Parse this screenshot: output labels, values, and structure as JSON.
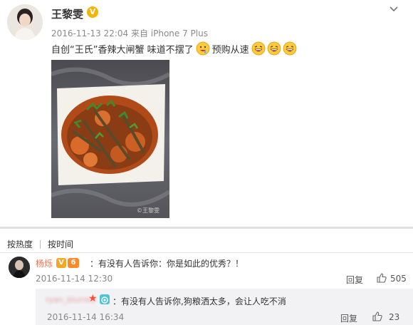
{
  "post": {
    "username": "王黎雯",
    "verified_badge": "V",
    "timestamp": "2016-11-13 22:04",
    "source": "来自 iPhone 7 Plus",
    "content_parts": [
      "自创“王氏”香辣大闸蟹 味道不摆了",
      "预购从速"
    ],
    "emojis": [
      "drooling-face-emoji",
      "laughing-face-emoji",
      "laughing-face-emoji",
      "laughing-face-emoji"
    ],
    "photo": "spicy-crab-dish-photo"
  },
  "sort_tabs": {
    "hot": "按热度",
    "time": "按时间"
  },
  "comment": {
    "username": "杨烁",
    "text": "：有没有人告诉你：你是如此的优秀？！",
    "timestamp": "2016-11-14 12:30",
    "reply_label": "回复",
    "like_count": "505"
  },
  "reply": {
    "username": "ryan_blurred",
    "text": "：有没有人告诉你,狗粮洒太多，会让人吃不消",
    "timestamp": "2016-11-14 16:34",
    "reply_label": "回复",
    "like_count": "23"
  },
  "colors": {
    "verified": "#f5b400",
    "commenter_name": "#eb7350",
    "reply_bg": "#f2f2f5"
  }
}
